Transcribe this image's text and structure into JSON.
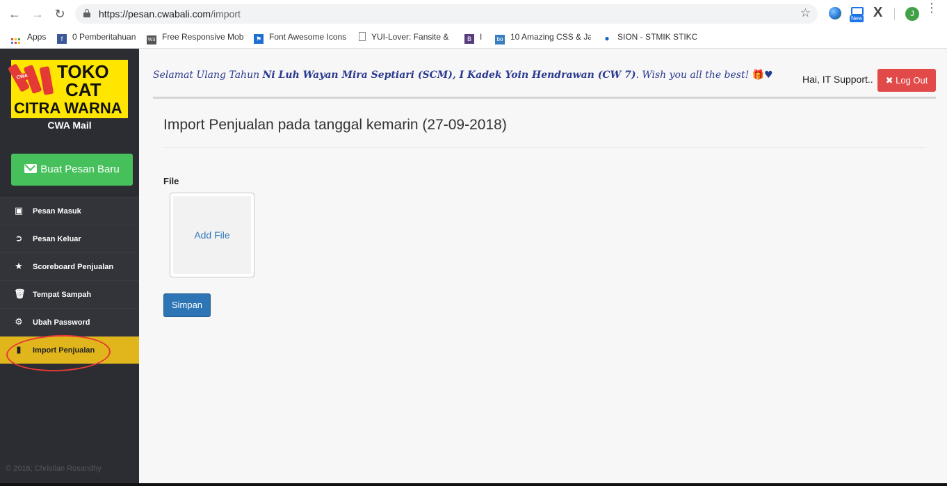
{
  "browser": {
    "url_host": "https://pesan.cwabali.com",
    "url_path": "/import",
    "profile_initial": "J",
    "ext_badge": "New"
  },
  "bookmarks": [
    {
      "label": "Apps"
    },
    {
      "label": "0 Pemberitahuan"
    },
    {
      "label": "Free Responsive Mob"
    },
    {
      "label": "Font Awesome Icons"
    },
    {
      "label": "YUI-Lover: Fansite &"
    },
    {
      "label": "I"
    },
    {
      "label": "10 Amazing CSS & Ja"
    },
    {
      "label": "SION - STMIK STIKOM"
    }
  ],
  "sidebar": {
    "logo": {
      "cwa": "CWA",
      "line1": "TOKO",
      "line2": "CAT",
      "line3": "CITRA WARNA"
    },
    "app_name": "CWA Mail",
    "compose_label": "Buat Pesan Baru",
    "items": [
      {
        "label": "Pesan Masuk",
        "icon": "inbox-icon"
      },
      {
        "label": "Pesan Keluar",
        "icon": "sign-out-icon"
      },
      {
        "label": "Scoreboard Penjualan",
        "icon": "star-icon"
      },
      {
        "label": "Tempat Sampah",
        "icon": "trash-icon"
      },
      {
        "label": "Ubah Password",
        "icon": "gear-icon"
      },
      {
        "label": "Import Penjualan",
        "icon": "file-icon"
      }
    ],
    "footer": "© 2016; Christian Rosandhy"
  },
  "header": {
    "birthday_prefix": "Selamat Ulang Tahun ",
    "birthday_names": "Ni Luh Wayan Mira Septiari (SCM), I Kadek Yoin Hendrawan (CW 7)",
    "birthday_suffix": ". Wish you all the best! ",
    "greeting": "Hai, IT Support..",
    "logout_label": "Log Out"
  },
  "main": {
    "title": "Import Penjualan pada tanggal kemarin (27-09-2018)",
    "file_label": "File",
    "add_file_label": "Add File",
    "save_label": "Simpan"
  },
  "colors": {
    "sidebar_bg": "#2b2d33",
    "active_item": "#e0b61c",
    "compose_green": "#46c05b",
    "logout_red": "#e24a4a",
    "primary_blue": "#2e75b6"
  }
}
